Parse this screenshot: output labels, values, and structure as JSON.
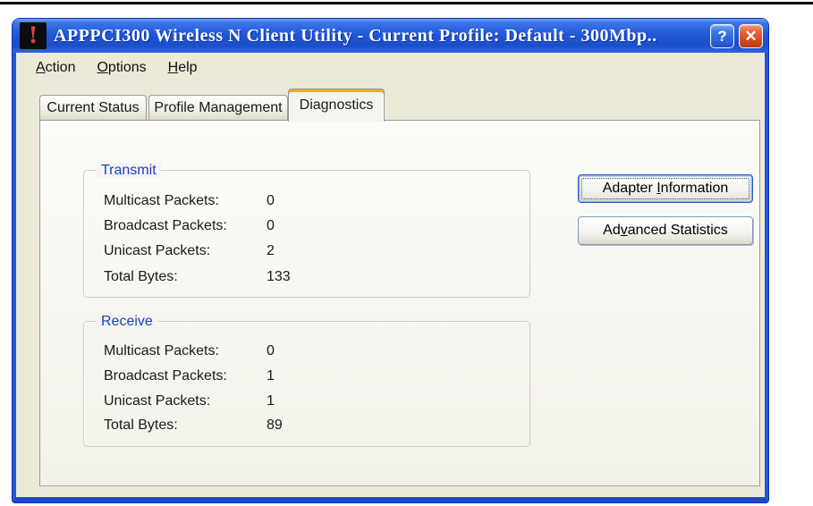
{
  "window": {
    "title": "APPPCI300 Wireless N Client Utility - Current Profile: Default - 300Mbp..",
    "icon_glyph": "!",
    "help_glyph": "?",
    "close_glyph": "✕"
  },
  "menu": {
    "items": [
      {
        "accel": "A",
        "rest": "ction"
      },
      {
        "accel": "O",
        "rest": "ptions"
      },
      {
        "accel": "H",
        "rest": "elp"
      }
    ]
  },
  "tabs": [
    {
      "label": "Current Status",
      "active": false
    },
    {
      "label": "Profile Management",
      "active": false
    },
    {
      "label": "Diagnostics",
      "active": true
    }
  ],
  "transmit": {
    "title": "Transmit",
    "rows": [
      {
        "label": "Multicast Packets:",
        "value": "0"
      },
      {
        "label": "Broadcast Packets:",
        "value": "0"
      },
      {
        "label": "Unicast Packets:",
        "value": "2"
      },
      {
        "label": "Total Bytes:",
        "value": "133"
      }
    ]
  },
  "receive": {
    "title": "Receive",
    "rows": [
      {
        "label": "Multicast Packets:",
        "value": "0"
      },
      {
        "label": "Broadcast Packets:",
        "value": "1"
      },
      {
        "label": "Unicast Packets:",
        "value": "1"
      },
      {
        "label": "Total Bytes:",
        "value": "89"
      }
    ]
  },
  "buttons": {
    "adapter_info": {
      "pre": "Adapter ",
      "accel": "I",
      "post": "nformation"
    },
    "advanced_stats": {
      "pre": "Ad",
      "accel": "v",
      "post": "anced Statistics"
    }
  },
  "colors": {
    "titlebar_blue": "#2158D8",
    "frame_blue": "#2456D8",
    "content_beige": "#ECE9D8",
    "tab_accent_orange": "#F5A623",
    "group_label_blue": "#1A3FC4",
    "close_red": "#D94E21"
  }
}
